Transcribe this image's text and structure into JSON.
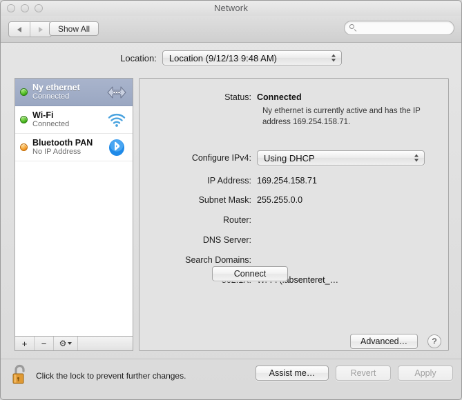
{
  "window": {
    "title": "Network",
    "traffic_lights": [
      "close",
      "minimize",
      "zoom"
    ]
  },
  "toolbar": {
    "back_label": "",
    "forward_label": "",
    "show_all_label": "Show All",
    "search": {
      "value": "",
      "placeholder": ""
    }
  },
  "location": {
    "label": "Location:",
    "selected": "Location (9/12/13 9:48 AM)"
  },
  "sidebar": {
    "services": [
      {
        "name": "Ny ethernet",
        "status": "Connected",
        "dot": "green",
        "icon": "ethernet-icon",
        "selected": true
      },
      {
        "name": "Wi-Fi",
        "status": "Connected",
        "dot": "green",
        "icon": "wifi-icon",
        "selected": false
      },
      {
        "name": "Bluetooth PAN",
        "status": "No IP Address",
        "dot": "amber",
        "icon": "bluetooth-icon",
        "selected": false
      }
    ],
    "toolbar": {
      "add_label": "+",
      "remove_label": "−",
      "actions_label": "⚙"
    }
  },
  "details": {
    "status_label": "Status:",
    "status_value": "Connected",
    "status_description": "Ny ethernet is currently active and has the IP address 169.254.158.71.",
    "configure_label": "Configure IPv4:",
    "configure_value": "Using DHCP",
    "ip_label": "IP Address:",
    "ip_value": "169.254.158.71",
    "subnet_label": "Subnet Mask:",
    "subnet_value": "255.255.0.0",
    "router_label": "Router:",
    "router_value": "",
    "dns_label": "DNS Server:",
    "dns_value": "",
    "search_domains_label": "Search Domains:",
    "search_domains_value": "",
    "dot1x_label": "802.1X:",
    "dot1x_value": "Wi-Fi (labsenteret_…",
    "connect_label": "Connect",
    "advanced_label": "Advanced…",
    "help_label": "?"
  },
  "bottom": {
    "lock_icon": "unlocked-padlock-icon",
    "lock_text": "Click the lock to prevent further changes.",
    "assist_label": "Assist me…",
    "revert_label": "Revert",
    "apply_label": "Apply"
  },
  "colors": {
    "selection": "#9aa7c2",
    "status_green": "#36a80f",
    "status_amber": "#f08a11",
    "bluetooth_blue": "#1f8ae8",
    "wifi_blue": "#4aa3df",
    "lock_orange": "#e09a34"
  }
}
